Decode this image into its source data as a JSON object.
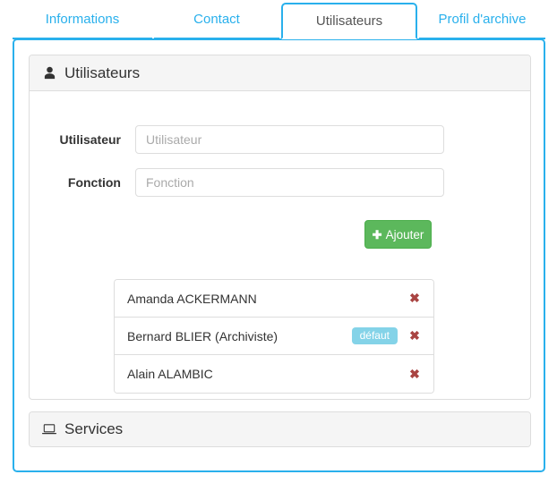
{
  "tabs": [
    {
      "label": "Informations",
      "active": false
    },
    {
      "label": "Contact",
      "active": false
    },
    {
      "label": "Utilisateurs",
      "active": true
    },
    {
      "label": "Profil d'archive",
      "active": false
    }
  ],
  "panels": {
    "users": {
      "title": "Utilisateurs",
      "icon": "user-icon",
      "form": {
        "user": {
          "label": "Utilisateur",
          "value": "",
          "placeholder": "Utilisateur"
        },
        "fonction": {
          "label": "Fonction",
          "value": "",
          "placeholder": "Fonction"
        }
      },
      "add_button": {
        "label": "Ajouter",
        "icon": "plus-icon"
      },
      "list": [
        {
          "name": "Amanda ACKERMANN",
          "badge": null,
          "delete_icon": "remove-icon"
        },
        {
          "name": "Bernard BLIER (Archiviste)",
          "badge": "défaut",
          "delete_icon": "remove-icon"
        },
        {
          "name": "Alain ALAMBIC",
          "badge": null,
          "delete_icon": "remove-icon"
        }
      ]
    },
    "services": {
      "title": "Services",
      "icon": "laptop-icon"
    }
  },
  "colors": {
    "accent_blue": "#29b0ec",
    "success_green": "#5cb85c",
    "badge_blue": "#84d3e8",
    "delete_red": "#a94442",
    "panel_border": "#dddddd"
  }
}
